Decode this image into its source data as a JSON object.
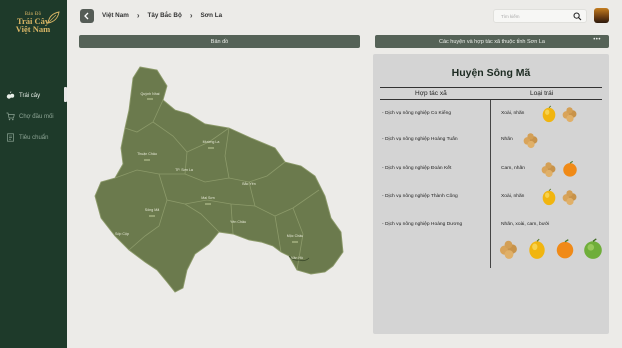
{
  "logo": {
    "line1": "Bản Đồ",
    "line2": "Trái Cây",
    "line3": "Việt Nam"
  },
  "sidebar": {
    "items": [
      {
        "label": "Trái cây",
        "icon": "fruits-icon",
        "active": true
      },
      {
        "label": "Chợ đầu mối",
        "icon": "cart-icon",
        "active": false
      },
      {
        "label": "Tiêu chuẩn",
        "icon": "document-icon",
        "active": false
      }
    ]
  },
  "breadcrumb": [
    "Việt Nam",
    "Tây Bắc Bộ",
    "Sơn La"
  ],
  "search": {
    "placeholder": "Tìm kiếm"
  },
  "map_bar": {
    "label": "Bản đồ"
  },
  "coop_bar": {
    "label": "Các huyện và hợp tác xã thuộc tỉnh Sơn La",
    "more": "•••"
  },
  "map": {
    "districts": [
      {
        "name": "Quỳnh Nhai"
      },
      {
        "name": "Thuận Châu"
      },
      {
        "name": "Mường La"
      },
      {
        "name": "TP. Sơn La"
      },
      {
        "name": "Bắc Yên"
      },
      {
        "name": "Mai Sơn"
      },
      {
        "name": "Sông Mã"
      },
      {
        "name": "Yên Châu"
      },
      {
        "name": "Sốp Cộp"
      },
      {
        "name": "Mộc Châu"
      },
      {
        "name": "Vân Hồ"
      }
    ],
    "colors": {
      "fill": "#6b7a4d",
      "stroke": "#8c9a6a"
    }
  },
  "panel": {
    "district_title": "Huyện Sông Mã",
    "col_coop": "Hợp tác xã",
    "col_fruit": "Loại trái",
    "rows": [
      {
        "coop": "- Dịch vụ nông nghiệp Co Kiểng",
        "fruit": "Xoài, nhãn",
        "icons": [
          "mango-icon",
          "longan-icon"
        ]
      },
      {
        "coop": "- Dịch vụ nông nghiệp Hoàng Tuấn",
        "fruit": "Nhãn",
        "icons": [
          "longan-icon"
        ]
      },
      {
        "coop": "- Dịch vụ nông nghiệp Đoàn Kết",
        "fruit": "Cam, nhãn",
        "icons": [
          "longan-icon",
          "orange-icon"
        ]
      },
      {
        "coop": "- Dịch vụ nông nghiệp Thành Công",
        "fruit": "Xoài, nhãn",
        "icons": [
          "mango-icon",
          "longan-icon"
        ]
      },
      {
        "coop": "- Dịch vụ nông nghiệp Hoàng Dương",
        "fruit": "Nhãn, xoài, cam, bưởi",
        "icons": [
          "longan-icon",
          "mango-icon",
          "orange-icon",
          "pomelo-icon"
        ]
      }
    ]
  }
}
